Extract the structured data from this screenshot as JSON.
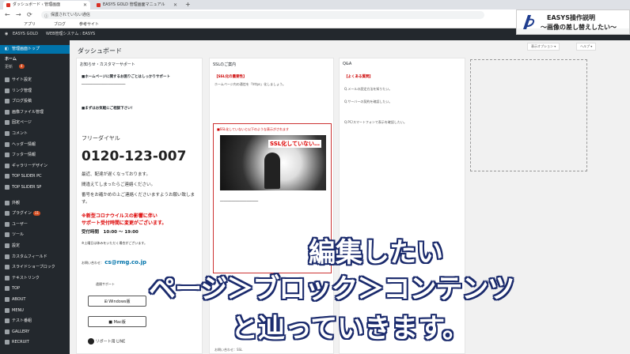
{
  "browser": {
    "tabs": [
      {
        "label": "ダッシュボード ‹ 管理画面"
      },
      {
        "label": "EASYS GOLD 管理画面マニュアル"
      }
    ],
    "new_tab": "+",
    "url": "保護されていない通信",
    "nav": {
      "back": "←",
      "forward": "→",
      "reload": "⟳"
    },
    "bookmarks": [
      "アプリ",
      "ブログ",
      "参考サイト"
    ]
  },
  "adminbar": {
    "items": [
      "EASYS GOLD",
      "WEB管理システム : EASYS"
    ]
  },
  "sidebar": {
    "top_label": "管理画面トップ",
    "home_label": "ホーム",
    "update_label": "更新",
    "update_count": "4",
    "items": [
      {
        "label": "サイト設定"
      },
      {
        "label": "リンク管理"
      },
      {
        "label": "ブログ投稿"
      },
      {
        "label": "画像ファイル管理"
      },
      {
        "label": "固定ページ"
      },
      {
        "label": "コメント"
      },
      {
        "label": "ヘッダー情報"
      },
      {
        "label": "フッター情報"
      },
      {
        "label": "ギャラリーデザイン"
      },
      {
        "label": "TOP SLIDER PC"
      },
      {
        "label": "TOP SLIDER SP"
      },
      {
        "label": "外観"
      },
      {
        "label": "プラグイン",
        "badge": "11"
      },
      {
        "label": "ユーザー"
      },
      {
        "label": "ツール"
      },
      {
        "label": "設定"
      },
      {
        "label": "カスタムフィールド"
      },
      {
        "label": "スライドショーブロック"
      },
      {
        "label": "テキストリンク"
      },
      {
        "label": "TOP"
      },
      {
        "label": "ABOUT"
      },
      {
        "label": "MENU"
      },
      {
        "label": "テスト番組"
      },
      {
        "label": "GALLERY"
      },
      {
        "label": "RECRUIT"
      }
    ]
  },
  "main": {
    "title": "ダッシュボード",
    "screen_options": "表示オプション ▾",
    "help": "ヘルプ ▾",
    "support": {
      "heading": "お知らせ・カスタマーサポート",
      "sub1": "■ホームページに関するお困りごとはしっかりサポート",
      "sub2": "■まずはお気軽にご相談下さい！",
      "free_dial": "フリーダイヤル",
      "phone": "0120-123-007",
      "body": [
        "最近、配達が遅くなっております。",
        "間違えてしまったらご連絡ください。",
        "番号をお確かめの上ご連絡くださいますようお願い致します。"
      ],
      "notice1": "※新型コロナウイルスの影響に伴い",
      "notice2": "サポート受付時間に変更がございます。",
      "hours": "受付時間　10:00 〜 19:00",
      "note": "※土曜日は休みをいただく場合がございます。",
      "email_label": "お問い合わせ：",
      "email": "cs@rmg.co.jp",
      "remote_label": "遠隔サポート",
      "windows_btn": "Windows版",
      "mac_btn": "Mac版",
      "line_label": "リポート用 LINE"
    },
    "ssl": {
      "heading": "SSLのご案内",
      "sub": "【SSL化の重要性】",
      "intro": "ホームページ内の通信を「https」化しましょう。",
      "image_caption": "SSL化していない…",
      "box_title": "■SSL化していないと以下のような表示がされます",
      "footer": "お問い合わせ：SSL"
    },
    "qa": {
      "heading": "Q&A",
      "sub": "【よくある質問】",
      "items": [
        "Q.メールの設定方法を知りたい。",
        "Q.サーバーの契約を確認したい。",
        "Q.PC/スマートフォンで表示を確認したい。"
      ]
    }
  },
  "overlay": {
    "logo_line1": "EASYS操作説明",
    "logo_line2": "〜画像の差し替えしたい〜",
    "caption_line1": "編集したい",
    "caption_line2": "ページ＞ブロック＞コンテンツ",
    "caption_line3": "と辿っていきます。"
  },
  "colors": {
    "sidebar_bg": "#23282d",
    "wp_blue": "#0073aa",
    "caption_stroke": "#1a2a6c",
    "alert_red": "#d00"
  }
}
